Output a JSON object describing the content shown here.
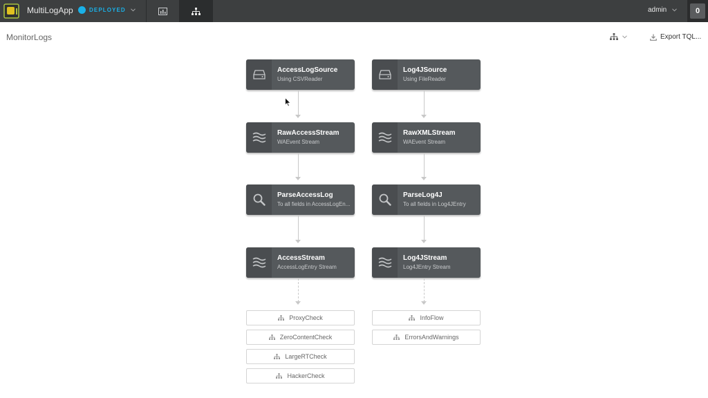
{
  "app": {
    "name": "MultiLogApp",
    "status": "DEPLOYED"
  },
  "nav": {
    "chart_icon": "bar-chart-icon",
    "flow_icon": "sitemap-icon"
  },
  "user": {
    "name": "admin",
    "notification_count": "0"
  },
  "page": {
    "title": "MonitorLogs",
    "layout_icon": "sitemap-icon",
    "export_label": "Export TQL..."
  },
  "flows": [
    {
      "nodes": [
        {
          "title": "AccessLogSource",
          "subtitle": "Using CSVReader",
          "icon": "drive-icon"
        },
        {
          "title": "RawAccessStream",
          "subtitle": "WAEvent Stream",
          "icon": "stream-icon"
        },
        {
          "title": "ParseAccessLog",
          "subtitle": "To all fields in AccessLogEn...",
          "icon": "search-icon"
        },
        {
          "title": "AccessStream",
          "subtitle": "AccessLogEntry Stream",
          "icon": "stream-icon"
        }
      ],
      "subflows": [
        "ProxyCheck",
        "ZeroContentCheck",
        "LargeRTCheck",
        "HackerCheck"
      ]
    },
    {
      "nodes": [
        {
          "title": "Log4JSource",
          "subtitle": "Using FileReader",
          "icon": "drive-icon"
        },
        {
          "title": "RawXMLStream",
          "subtitle": "WAEvent Stream",
          "icon": "stream-icon"
        },
        {
          "title": "ParseLog4J",
          "subtitle": "To all fields in Log4JEntry",
          "icon": "search-icon"
        },
        {
          "title": "Log4JStream",
          "subtitle": "Log4JEntry Stream",
          "icon": "stream-icon"
        }
      ],
      "subflows": [
        "InfoFlow",
        "ErrorsAndWarnings"
      ]
    }
  ],
  "colors": {
    "topbar": "#3d3f40",
    "accent": "#1ab1e8",
    "node": "#55595c",
    "node_icon_bg": "#4a4d50"
  }
}
